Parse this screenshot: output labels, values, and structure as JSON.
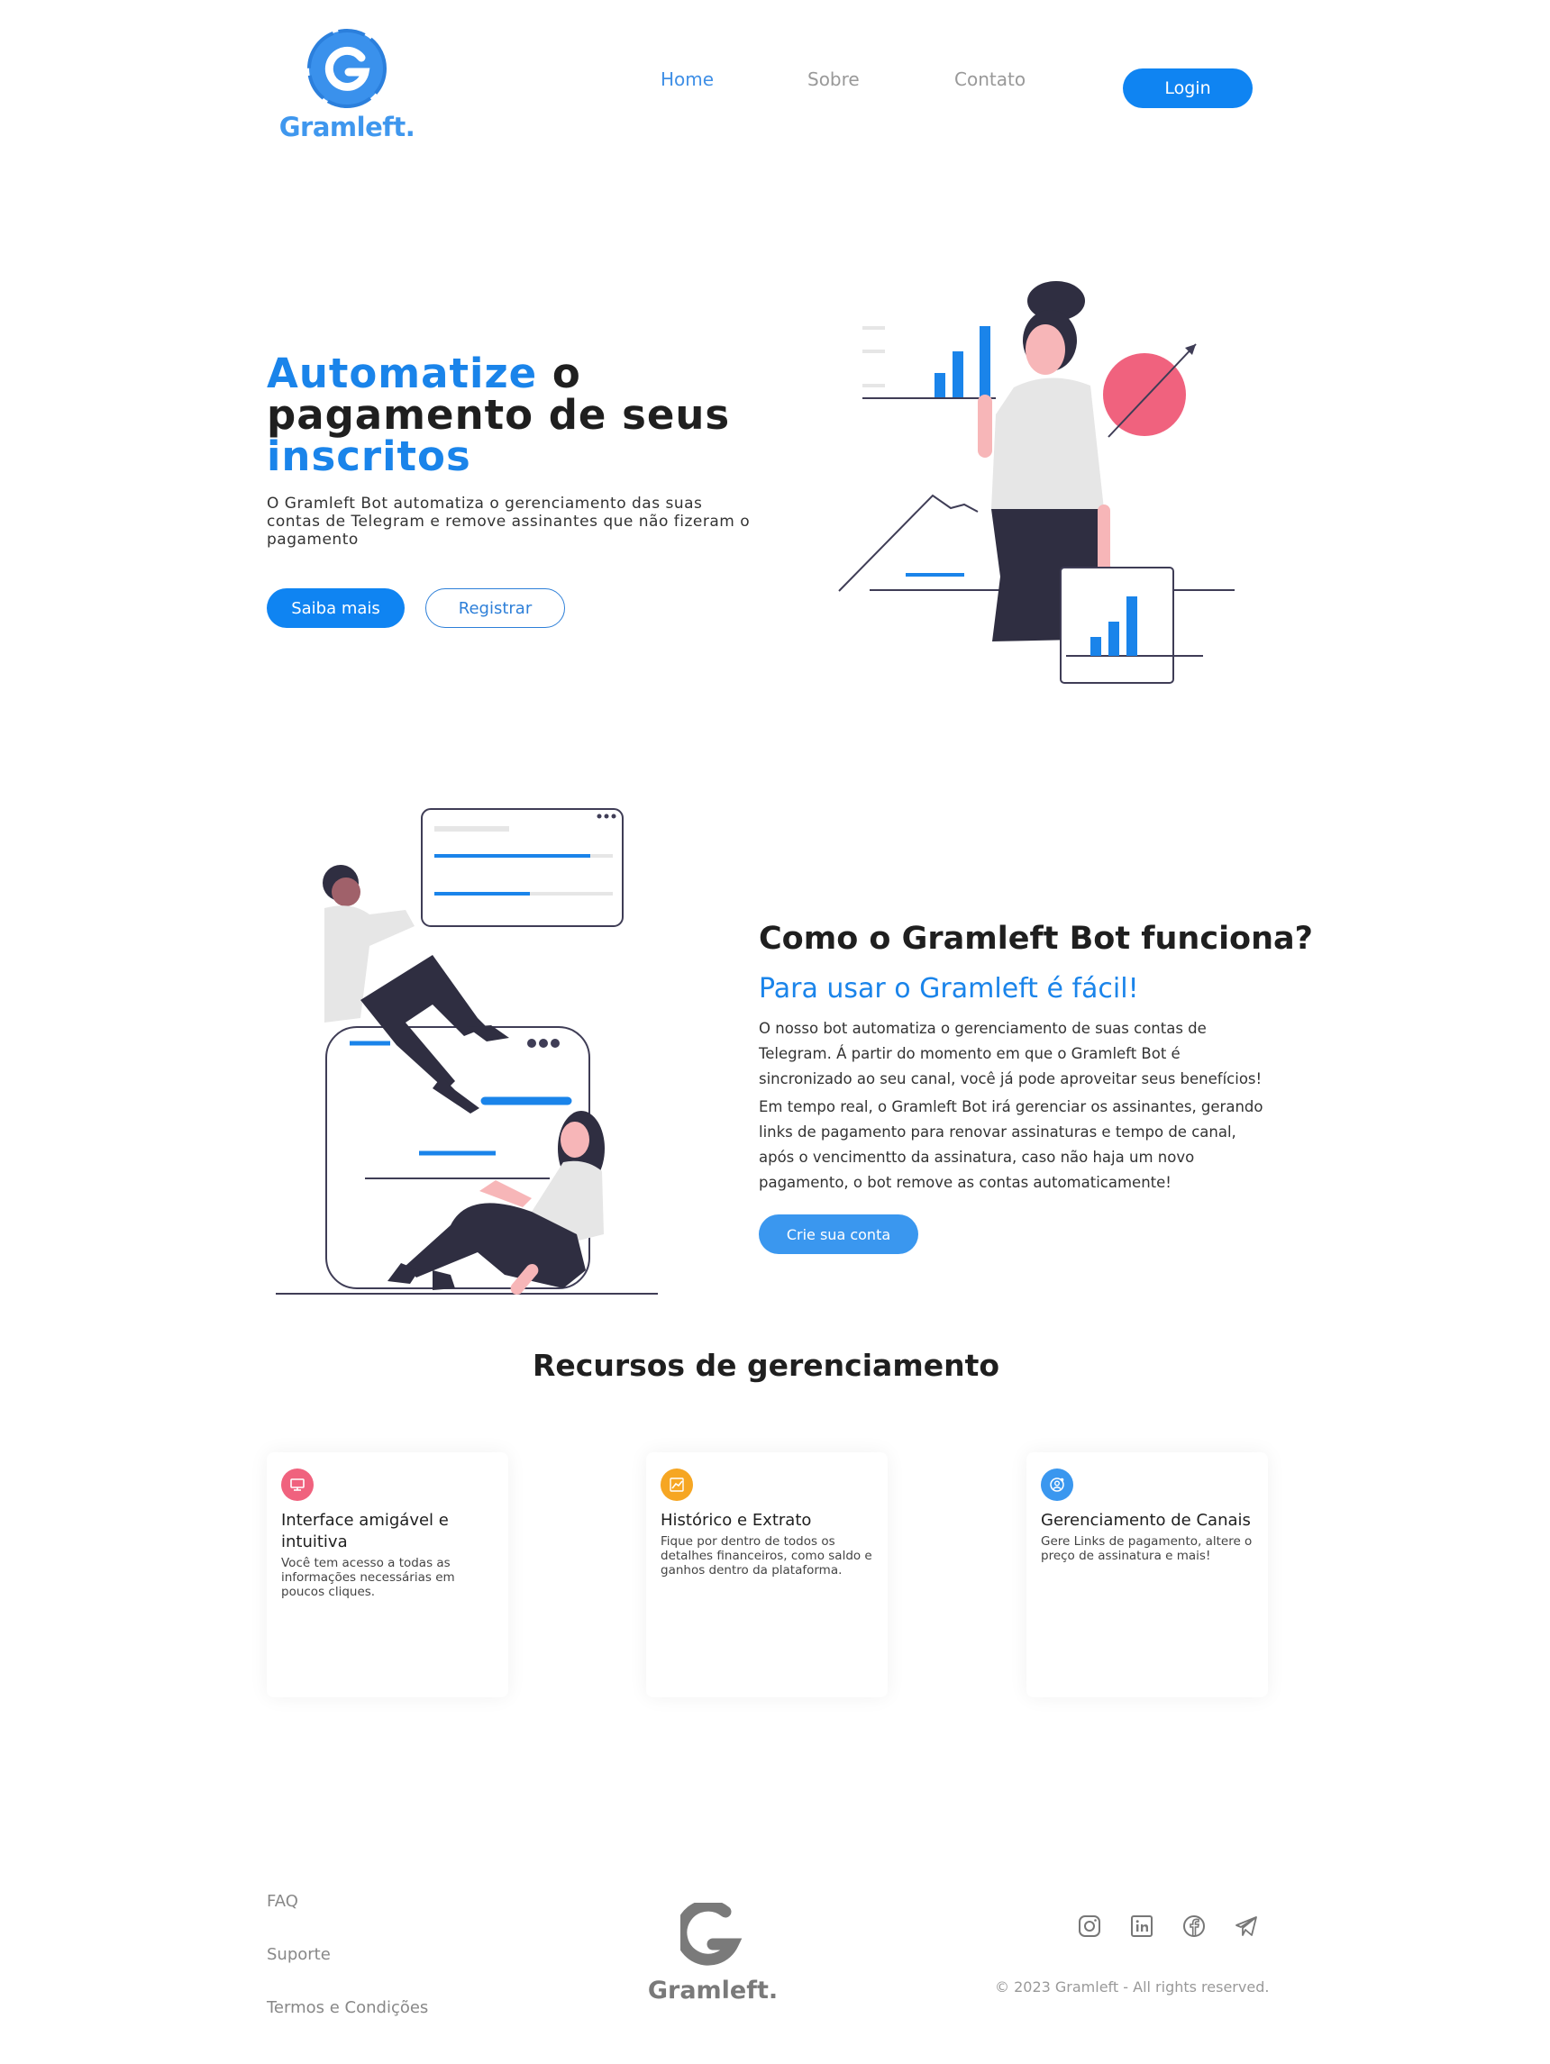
{
  "brand": {
    "name": "Gramleft.",
    "accent": "#0f84f2",
    "logo_icon": "g-logo-icon"
  },
  "nav": {
    "items": [
      {
        "label": "Home",
        "active": true
      },
      {
        "label": "Sobre",
        "active": false
      },
      {
        "label": "Contato",
        "active": false
      }
    ],
    "login_label": "Login"
  },
  "hero": {
    "title_blue_1": "Automatize",
    "title_dark_1": " o",
    "title_dark_2": "pagamento de seus",
    "title_blue_2": "inscritos",
    "description": "O Gramleft Bot automatiza o gerenciamento das suas contas de Telegram e remove assinantes que não fizeram o pagamento",
    "primary_button": "Saiba mais",
    "secondary_button": "Registrar"
  },
  "how": {
    "title": "Como o Gramleft Bot funciona?",
    "subtitle": "Para usar o Gramleft é fácil!",
    "paragraph_1": "O nosso bot automatiza o gerenciamento de suas contas de Telegram. Á partir do momento em que o Gramleft Bot é sincronizado ao seu canal, você já pode aproveitar seus benefícios!",
    "paragraph_2": "Em tempo real, o Gramleft Bot irá gerenciar os assinantes, gerando links de pagamento para renovar assinaturas e tempo de canal, após o vencimentto da assinatura, caso não haja um novo pagamento, o bot remove as contas automaticamente!",
    "button": "Crie sua conta"
  },
  "resources": {
    "title": "Recursos de gerenciamento",
    "cards": [
      {
        "icon": "monitor-icon",
        "color": "#f0627e",
        "title": "Interface amigável e intuitiva",
        "description": "Você tem acesso a todas as informações necessárias em poucos cliques."
      },
      {
        "icon": "chart-up-icon",
        "color": "#f6a623",
        "title": "Histórico e Extrato",
        "description": "Fique por dentro de todos os detalhes financeiros, como saldo e ganhos dentro da plataforma."
      },
      {
        "icon": "user-gear-icon",
        "color": "#3a97ef",
        "title": "Gerenciamento de Canais",
        "description": "Gere Links de pagamento, altere o preço de assinatura e mais!"
      }
    ]
  },
  "footer": {
    "links": [
      "FAQ",
      "Suporte",
      "Termos e Condições"
    ],
    "logo_text": "Gramleft.",
    "socials": [
      "instagram-icon",
      "linkedin-icon",
      "facebook-icon",
      "telegram-icon"
    ],
    "copyright": "© 2023 Gramleft - All rights reserved."
  }
}
